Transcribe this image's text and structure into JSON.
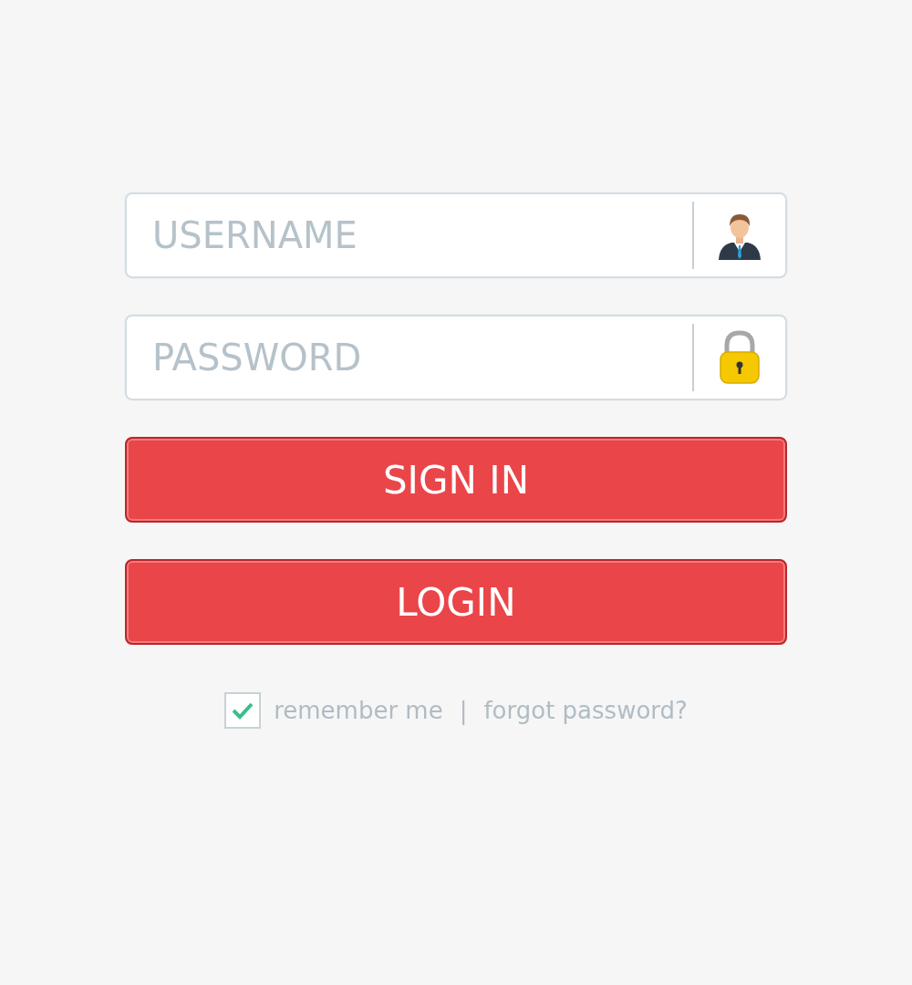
{
  "fields": [
    {
      "kind": "username",
      "placeholder": "USERNAME"
    },
    {
      "kind": "password",
      "placeholder": "PASSWORD"
    }
  ],
  "buttons": [
    {
      "label": "SIGN IN"
    },
    {
      "label": "LOGIN"
    }
  ],
  "remember": {
    "checked": true,
    "label": "remember me"
  },
  "separator": "|",
  "forgot_link": "forgot password?"
}
